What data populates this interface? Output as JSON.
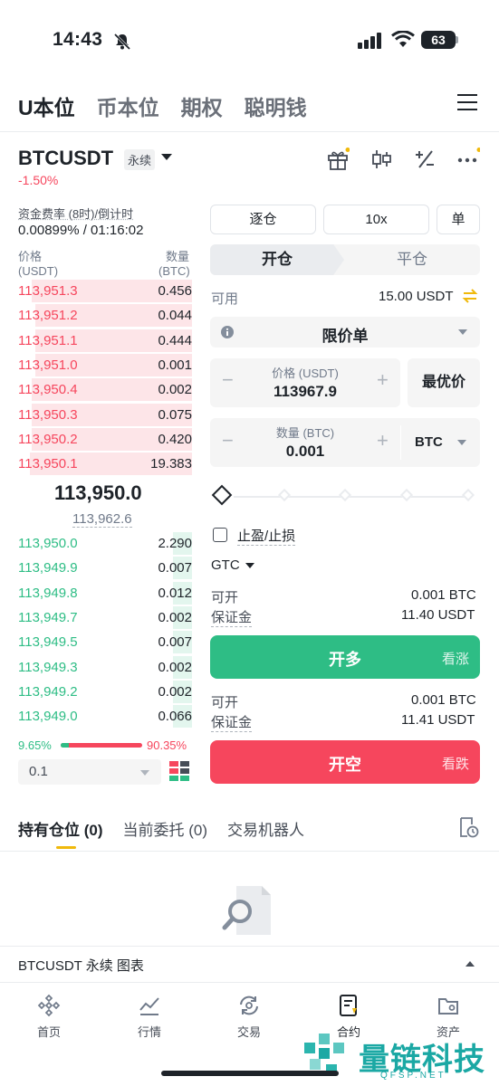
{
  "status_bar": {
    "time": "14:43",
    "battery": "63"
  },
  "top_tabs": [
    "U本位",
    "币本位",
    "期权",
    "聪明钱"
  ],
  "header": {
    "symbol": "BTCUSDT",
    "contract_type": "永续",
    "change": "-1.50%"
  },
  "funding": {
    "label": "资金费率 (8时)/倒计时",
    "value": "0.00899% / 01:16:02"
  },
  "orderbook": {
    "price_label": "价格",
    "price_unit": "(USDT)",
    "qty_label": "数量",
    "qty_unit": "(BTC)",
    "asks": [
      {
        "price": "113,951.3",
        "qty": "0.456",
        "depth": 0.92
      },
      {
        "price": "113,951.2",
        "qty": "0.044",
        "depth": 0.9
      },
      {
        "price": "113,951.1",
        "qty": "0.444",
        "depth": 0.9
      },
      {
        "price": "113,951.0",
        "qty": "0.001",
        "depth": 0.9
      },
      {
        "price": "113,950.4",
        "qty": "0.002",
        "depth": 0.92
      },
      {
        "price": "113,950.3",
        "qty": "0.075",
        "depth": 0.92
      },
      {
        "price": "113,950.2",
        "qty": "0.420",
        "depth": 0.92
      },
      {
        "price": "113,950.1",
        "qty": "19.383",
        "depth": 0.93
      }
    ],
    "last_price": "113,950.0",
    "mark_price": "113,962.6",
    "bids": [
      {
        "price": "113,950.0",
        "qty": "2.290",
        "depth": 0.11
      },
      {
        "price": "113,949.9",
        "qty": "0.007",
        "depth": 0.11
      },
      {
        "price": "113,949.8",
        "qty": "0.012",
        "depth": 0.11
      },
      {
        "price": "113,949.7",
        "qty": "0.002",
        "depth": 0.11
      },
      {
        "price": "113,949.5",
        "qty": "0.007",
        "depth": 0.11
      },
      {
        "price": "113,949.3",
        "qty": "0.002",
        "depth": 0.11
      },
      {
        "price": "113,949.2",
        "qty": "0.002",
        "depth": 0.11
      },
      {
        "price": "113,949.0",
        "qty": "0.066",
        "depth": 0.11
      }
    ],
    "buy_ratio": "9.65%",
    "sell_ratio": "90.35%",
    "step": "0.1"
  },
  "order_form": {
    "margin_mode": "逐仓",
    "leverage": "10x",
    "position_mode": "单",
    "open_tab": "开仓",
    "close_tab": "平仓",
    "available_label": "可用",
    "available_value": "15.00 USDT",
    "order_type": "限价单",
    "price_label": "价格 (USDT)",
    "price_value": "113967.9",
    "best_price": "最优价",
    "qty_label": "数量 (BTC)",
    "qty_value": "0.001",
    "qty_unit": "BTC",
    "tpsl_label": "止盈/止损",
    "tif": "GTC",
    "long": {
      "can_open_label": "可开",
      "can_open_value": "0.001 BTC",
      "margin_label": "保证金",
      "margin_value": "11.40 USDT",
      "button": "开多",
      "button_sub": "看涨"
    },
    "short": {
      "can_open_label": "可开",
      "can_open_value": "0.001 BTC",
      "margin_label": "保证金",
      "margin_value": "11.41 USDT",
      "button": "开空",
      "button_sub": "看跌"
    }
  },
  "positions_tabs": [
    "持有仓位 (0)",
    "当前委托 (0)",
    "交易机器人"
  ],
  "bottom_chart_label": "BTCUSDT 永续  图表",
  "bottom_nav": [
    "首页",
    "行情",
    "交易",
    "合约",
    "资产"
  ],
  "watermark": {
    "text": "量链科技",
    "sub": "QFSP.NET"
  },
  "colors": {
    "buy": "#2ebd85",
    "sell": "#f6465d",
    "accent": "#f0b90b"
  }
}
